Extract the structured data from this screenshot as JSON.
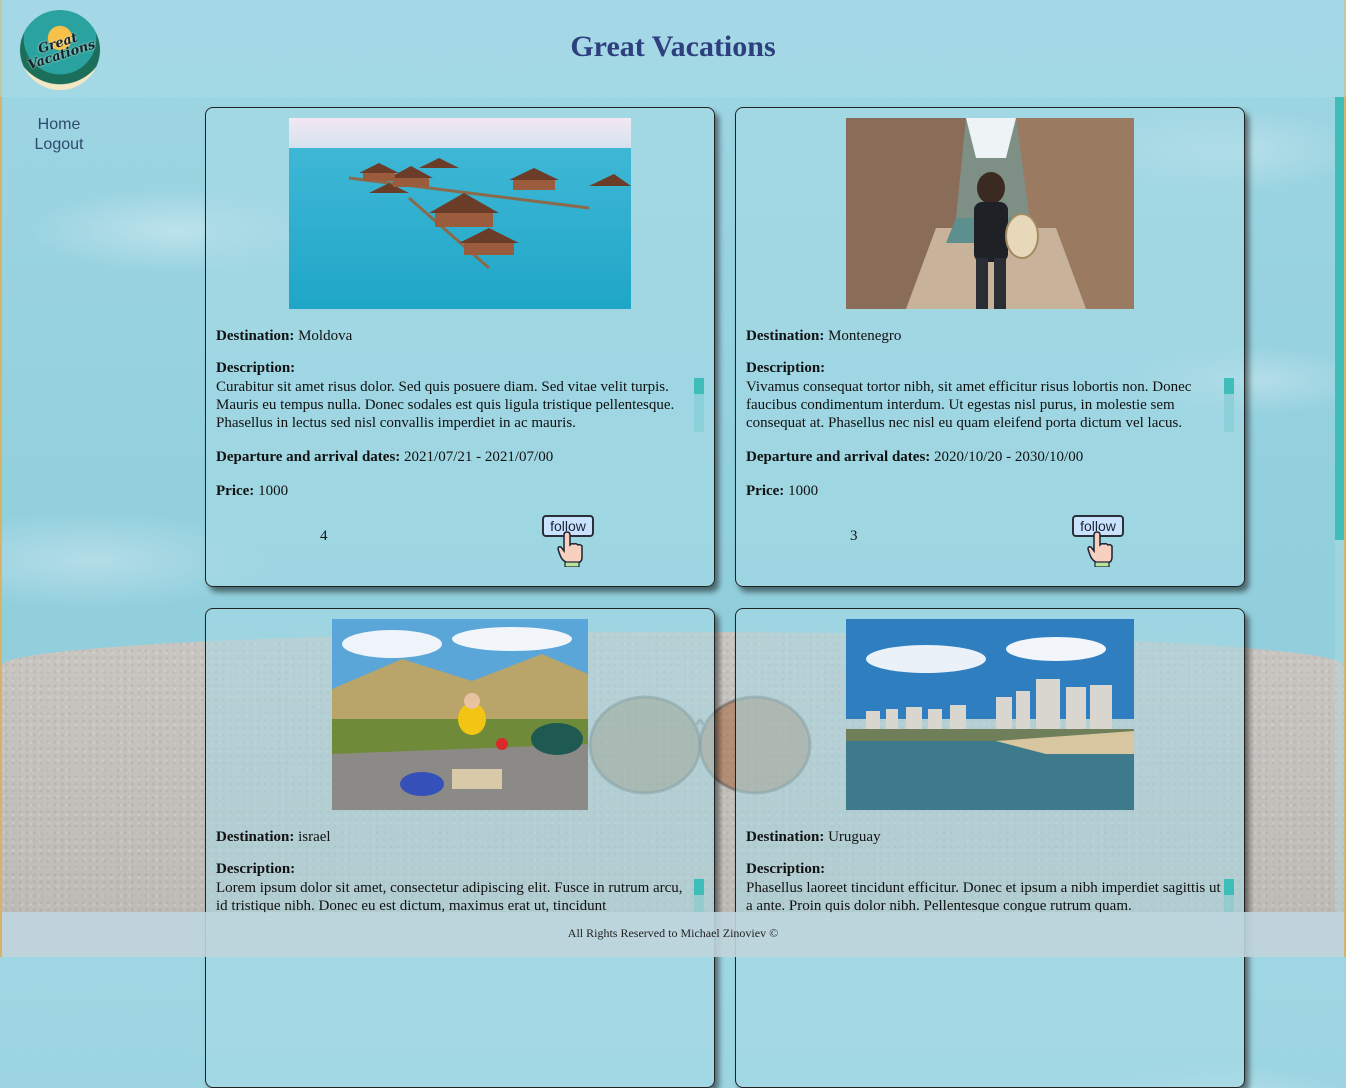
{
  "header": {
    "logo_text": "Great Vacations",
    "title": "Great Vacations"
  },
  "nav": {
    "home": "Home",
    "logout": "Logout"
  },
  "labels": {
    "destination": "Destination:",
    "description": "Description:",
    "dates": "Departure and arrival dates:",
    "price": "Price:",
    "follow": "follow"
  },
  "cards": [
    {
      "destination": "Moldova",
      "description": "Curabitur sit amet risus dolor. Sed quis posuere diam. Sed vitae velit turpis. Mauris eu tempus nulla. Donec sodales est quis ligula tristique pellentesque. Phasellus in lectus sed nisl convallis imperdiet in ac mauris.",
      "dates": "2021/07/21 - 2021/07/00",
      "price": "1000",
      "followers": "4",
      "image": "overwater-bungalows-icon"
    },
    {
      "destination": "Montenegro",
      "description": "Vivamus consequat tortor nibh, sit amet efficitur risus lobortis non. Donec faucibus condimentum interdum. Ut egestas nisl purus, in molestie sem consequat at. Phasellus nec nisl eu quam eleifend porta dictum vel lacus.",
      "dates": "2020/10/20 - 2030/10/00",
      "price": "1000",
      "followers": "3",
      "image": "canyon-hiker-icon"
    },
    {
      "destination": "israel",
      "description": "Lorem ipsum dolor sit amet, consectetur adipiscing elit. Fusce in rutrum arcu, id tristique nibh. Donec eu est dictum, maximus erat ut, tincidunt",
      "image": "desert-picnic-icon"
    },
    {
      "destination": "Uruguay",
      "description": "Phasellus laoreet tincidunt efficitur. Donec et ipsum a nibh imperdiet sagittis ut a ante. Proin quis dolor nibh. Pellentesque congue rutrum quam.",
      "image": "coastal-city-icon"
    }
  ],
  "footer": {
    "text": "All Rights Reserved to Michael Zinoviev ©"
  },
  "colors": {
    "title": "#2e3f7d",
    "accent": "#3fbdb8",
    "background": "#9fd6e3"
  }
}
